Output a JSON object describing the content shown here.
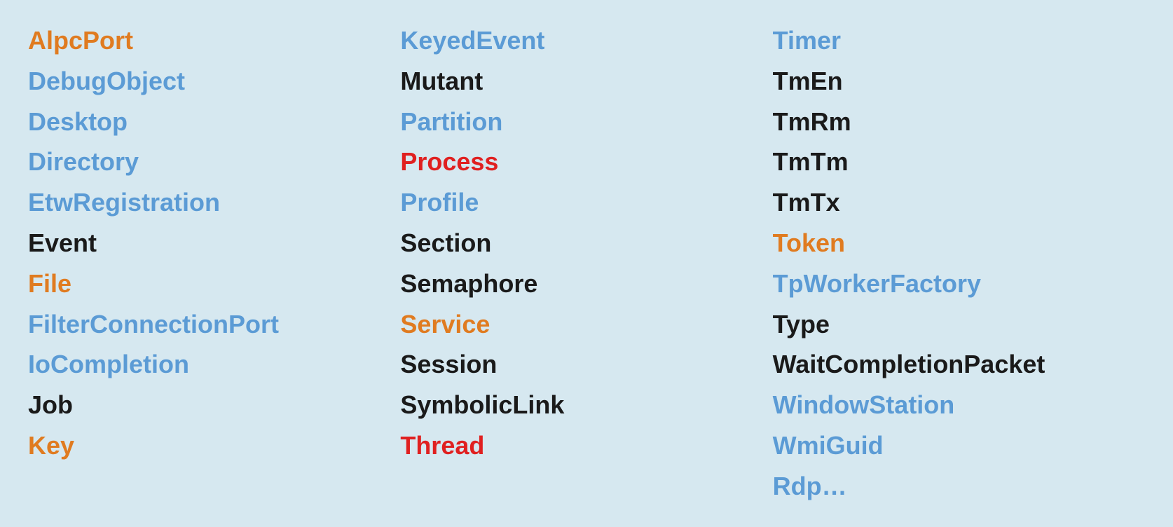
{
  "columns": [
    {
      "id": "col1",
      "items": [
        {
          "label": "AlpcPort",
          "color": "orange"
        },
        {
          "label": "DebugObject",
          "color": "blue"
        },
        {
          "label": "Desktop",
          "color": "blue"
        },
        {
          "label": "Directory",
          "color": "blue"
        },
        {
          "label": "EtwRegistration",
          "color": "blue"
        },
        {
          "label": "Event",
          "color": "black"
        },
        {
          "label": "File",
          "color": "orange"
        },
        {
          "label": "FilterConnectionPort",
          "color": "blue"
        },
        {
          "label": "IoCompletion",
          "color": "blue"
        },
        {
          "label": "Job",
          "color": "black"
        },
        {
          "label": "Key",
          "color": "orange"
        }
      ]
    },
    {
      "id": "col2",
      "items": [
        {
          "label": "KeyedEvent",
          "color": "blue"
        },
        {
          "label": "Mutant",
          "color": "black"
        },
        {
          "label": "Partition",
          "color": "blue"
        },
        {
          "label": "Process",
          "color": "red"
        },
        {
          "label": "Profile",
          "color": "blue"
        },
        {
          "label": "Section",
          "color": "black"
        },
        {
          "label": "Semaphore",
          "color": "black"
        },
        {
          "label": "Service",
          "color": "orange"
        },
        {
          "label": "Session",
          "color": "black"
        },
        {
          "label": "SymbolicLink",
          "color": "black"
        },
        {
          "label": "Thread",
          "color": "red"
        }
      ]
    },
    {
      "id": "col3",
      "items": [
        {
          "label": "Timer",
          "color": "blue"
        },
        {
          "label": "TmEn",
          "color": "black"
        },
        {
          "label": "TmRm",
          "color": "black"
        },
        {
          "label": "TmTm",
          "color": "black"
        },
        {
          "label": "TmTx",
          "color": "black"
        },
        {
          "label": "Token",
          "color": "orange"
        },
        {
          "label": "TpWorkerFactory",
          "color": "blue"
        },
        {
          "label": "Type",
          "color": "black"
        },
        {
          "label": "WaitCompletionPacket",
          "color": "black"
        },
        {
          "label": "WindowStation",
          "color": "blue"
        },
        {
          "label": "WmiGuid",
          "color": "blue"
        },
        {
          "label": "Rdp…",
          "color": "blue"
        }
      ]
    }
  ]
}
